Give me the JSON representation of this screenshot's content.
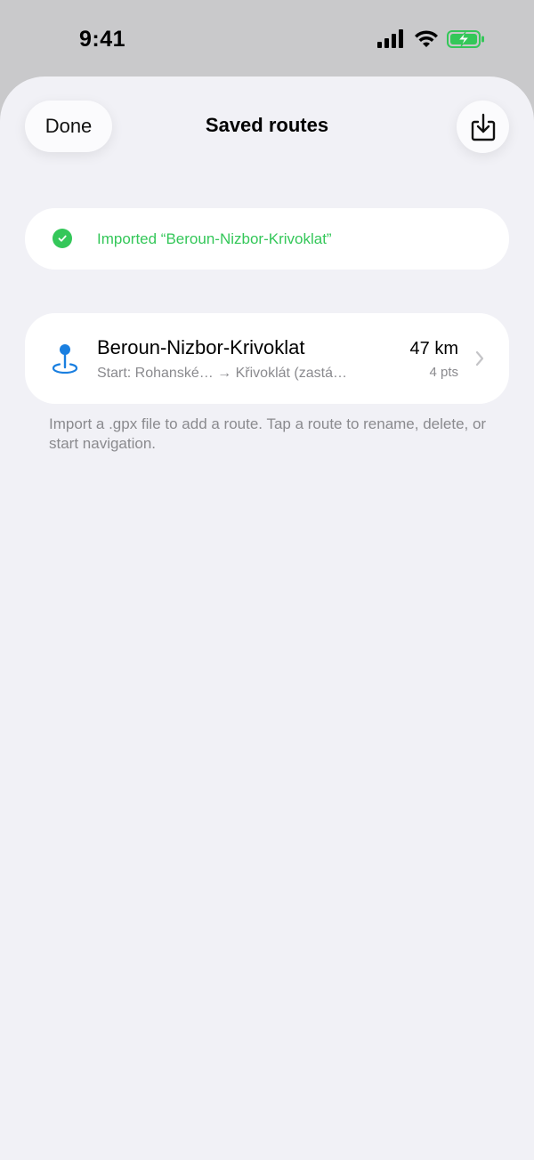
{
  "status_bar": {
    "time": "9:41",
    "icons": [
      "signal-icon",
      "wifi-icon",
      "battery-charging-icon"
    ],
    "battery_color": "#34c759"
  },
  "nav": {
    "done_label": "Done",
    "title": "Saved routes",
    "import_icon": "import-tray-icon"
  },
  "banner": {
    "icon": "checkmark-circle-icon",
    "text": "Imported “Beroun-Nizbor-Krivoklat”",
    "color": "#34c759"
  },
  "routes": [
    {
      "icon": "route-pin-icon",
      "name": "Beroun-Nizbor-Krivoklat",
      "subtitle": "Start: Rohanské… → Křivoklát (zastá…",
      "distance": "47 km",
      "points": "4 pts"
    }
  ],
  "footer_note": "Import a .gpx file to add a route. Tap a route to rename, delete, or start navigation.",
  "colors": {
    "accent": "#1a7fe0",
    "sheet_background": "#f1f1f6",
    "success": "#34c759"
  }
}
